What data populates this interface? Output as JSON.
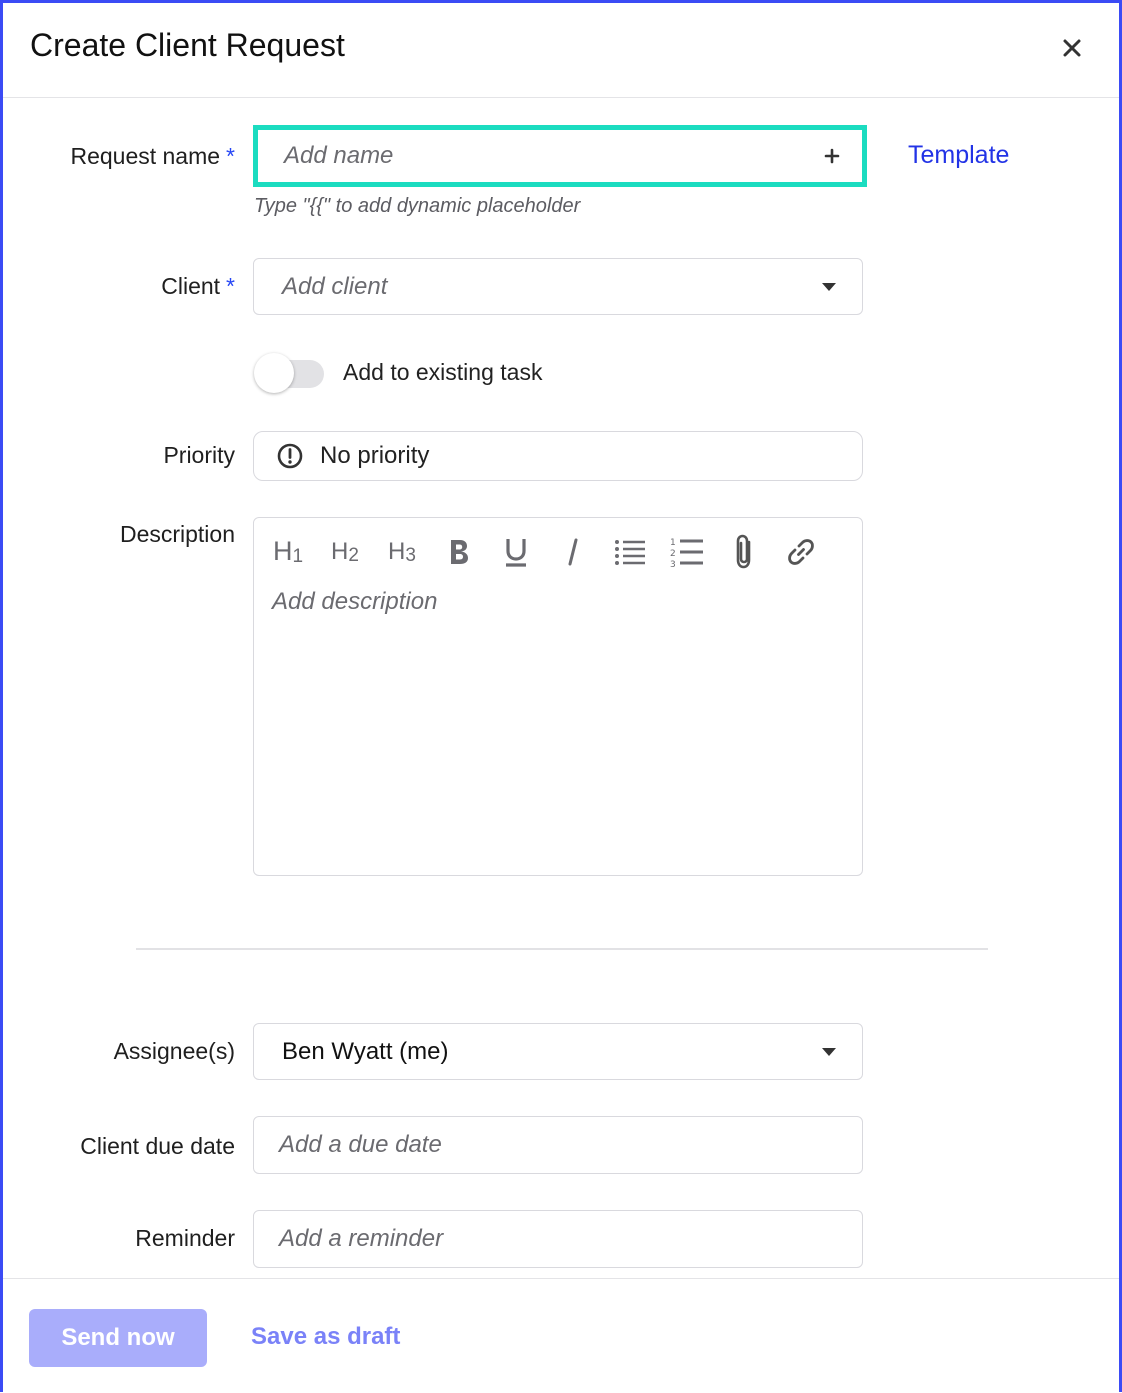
{
  "dialog": {
    "title": "Create Client Request",
    "close_icon": "close-icon"
  },
  "request_name": {
    "label": "Request name",
    "required_mark": "*",
    "placeholder": "Add name",
    "add_icon": "plus-icon",
    "template_link": "Template",
    "hint": "Type \"{{\" to add dynamic placeholder",
    "highlight_color": "#1bdcc0"
  },
  "client": {
    "label": "Client",
    "required_mark": "*",
    "placeholder": "Add client"
  },
  "existing_task": {
    "label": "Add to existing task",
    "enabled": false
  },
  "priority": {
    "label": "Priority",
    "value": "No priority",
    "icon": "exclamation-circle-icon"
  },
  "description": {
    "label": "Description",
    "placeholder": "Add description",
    "toolbar": [
      "heading-1",
      "heading-2",
      "heading-3",
      "bold",
      "underline",
      "italic",
      "bulleted-list",
      "numbered-list",
      "attachment",
      "link"
    ]
  },
  "assignees": {
    "label": "Assignee(s)",
    "value": "Ben Wyatt (me)"
  },
  "client_due_date": {
    "label": "Client due date",
    "placeholder": "Add a due date"
  },
  "reminder": {
    "label": "Reminder",
    "placeholder": "Add a reminder"
  },
  "footer": {
    "send_label": "Send now",
    "draft_label": "Save as draft"
  },
  "colors": {
    "accent": "#2233e6",
    "frame_border": "#3b4bf5",
    "send_button_disabled": "#a9adfb"
  }
}
